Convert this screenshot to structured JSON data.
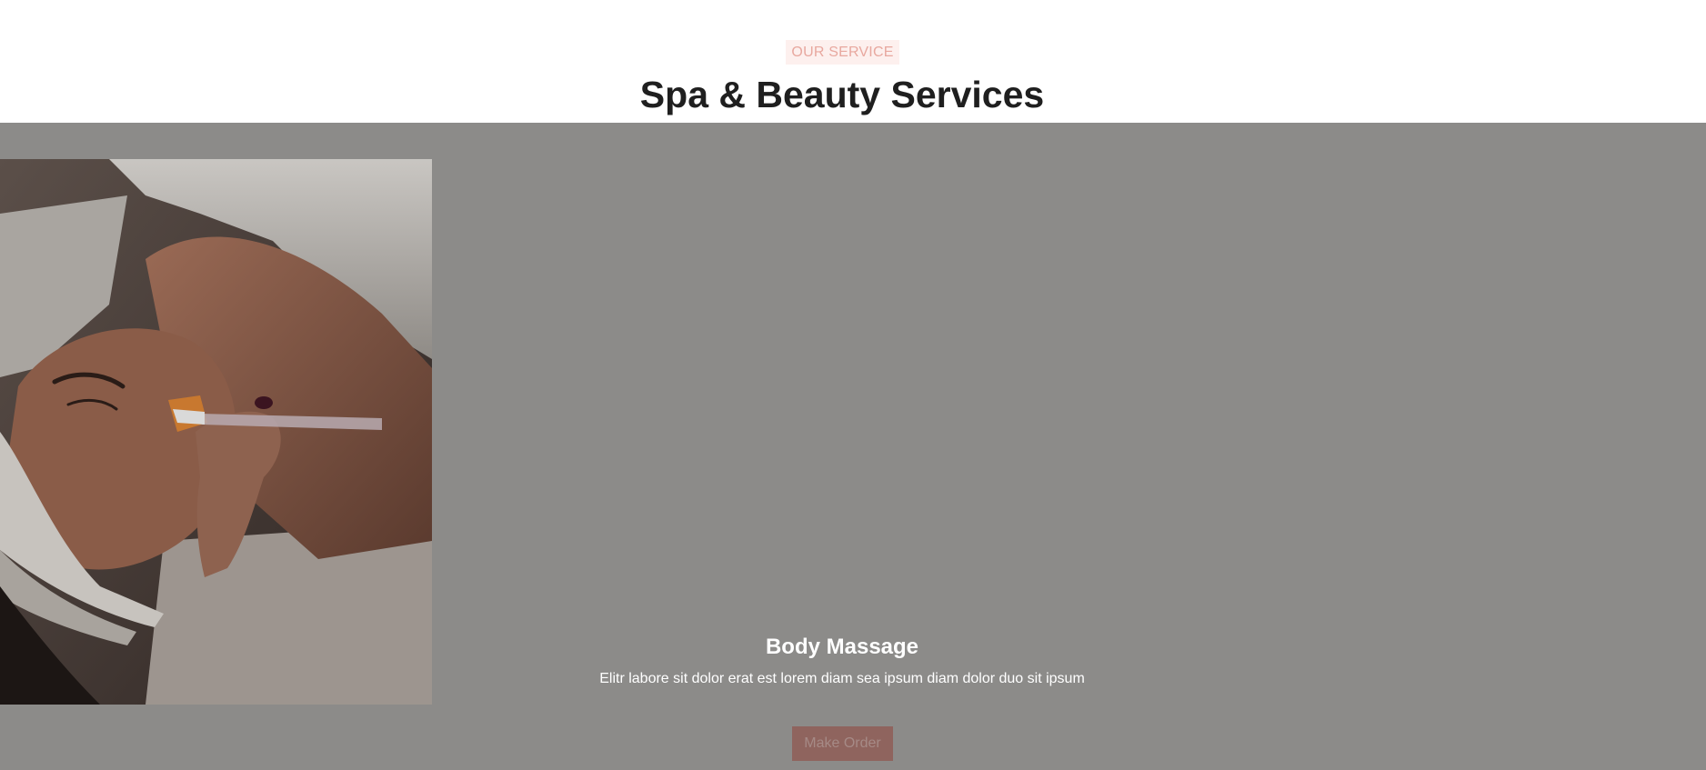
{
  "section": {
    "eyebrow": "OUR SERVICE",
    "title": "Spa & Beauty Services"
  },
  "service": {
    "image_alt": "Facial treatment with brush applying mask",
    "title": "Body Massage",
    "description": "Elitr labore sit dolor erat est lorem diam sea ipsum diam dolor duo sit ipsum",
    "button_label": "Make Order"
  },
  "colors": {
    "accent": "#e8a89f",
    "accent_bg": "#fdf0ee",
    "overlay": "#8c8b89",
    "button_bg": "#8f645e",
    "heading": "#1f1f1f"
  }
}
